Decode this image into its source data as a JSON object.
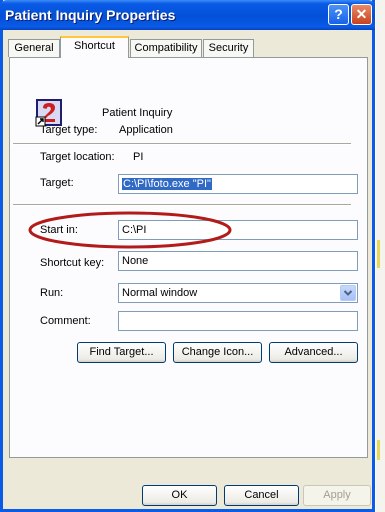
{
  "window": {
    "title": "Patient Inquiry Properties",
    "help_glyph": "?",
    "close_glyph": "✕"
  },
  "tabs": [
    {
      "label": "General",
      "active": false
    },
    {
      "label": "Shortcut",
      "active": true
    },
    {
      "label": "Compatibility",
      "active": false
    },
    {
      "label": "Security",
      "active": false
    }
  ],
  "shortcut": {
    "name": "Patient Inquiry",
    "target_type_label": "Target type:",
    "target_type_value": "Application",
    "target_location_label": "Target location:",
    "target_location_value": "PI",
    "target_label": "Target:",
    "target_value": "C:\\PI\\foto.exe \"PI\"",
    "start_in_label": "Start in:",
    "start_in_value": "C:\\PI",
    "shortcut_key_label": "Shortcut key:",
    "shortcut_key_value": "None",
    "run_label": "Run:",
    "run_value": "Normal window",
    "comment_label": "Comment:",
    "comment_value": ""
  },
  "panel_buttons": {
    "find_target": "Find Target...",
    "change_icon": "Change Icon...",
    "advanced": "Advanced..."
  },
  "dialog_buttons": {
    "ok": "OK",
    "cancel": "Cancel",
    "apply": "Apply"
  },
  "colors": {
    "title_bar": "#0a5be6",
    "highlight_ellipse": "#b31b1b",
    "selection": "#316ac5"
  }
}
